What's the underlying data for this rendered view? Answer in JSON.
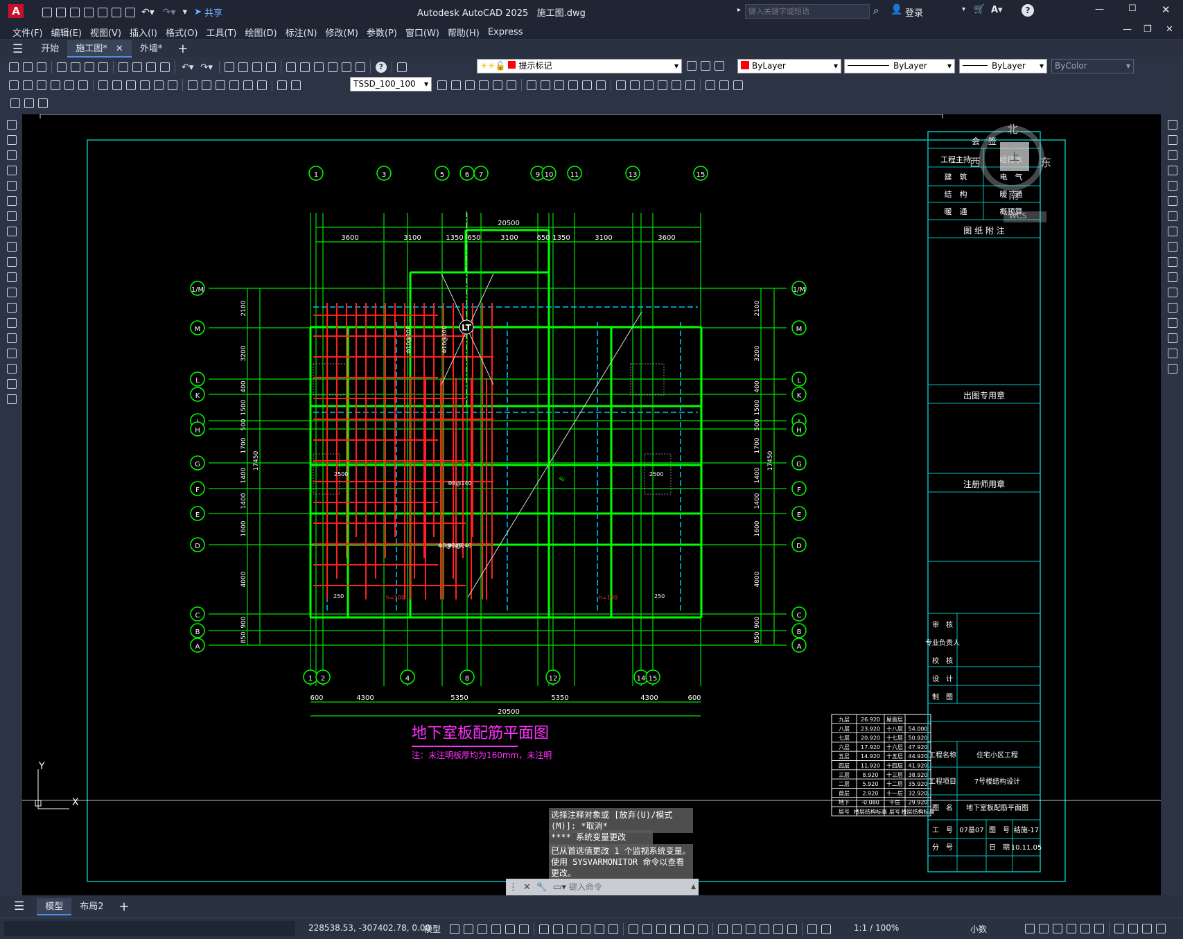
{
  "app": {
    "title": "Autodesk AutoCAD 2025",
    "file": "施工图.dwg",
    "share": "共享",
    "search_placeholder": "键入关键字或短语",
    "login": "登录"
  },
  "menu": [
    "文件(F)",
    "编辑(E)",
    "视图(V)",
    "插入(I)",
    "格式(O)",
    "工具(T)",
    "绘图(D)",
    "标注(N)",
    "修改(M)",
    "参数(P)",
    "窗口(W)",
    "帮助(H)",
    "Express"
  ],
  "doc_tabs": [
    {
      "label": "开始",
      "active": false
    },
    {
      "label": "施工图*",
      "active": true
    },
    {
      "label": "外墙*",
      "active": false
    }
  ],
  "toolbar": {
    "layer": "提示标记",
    "color": "ByLayer",
    "linetype": "ByLayer",
    "lineweight": "ByLayer",
    "plotstyle": "ByColor",
    "dimstyle": "TSSD_100_100"
  },
  "viewcube": {
    "north": "北",
    "south": "南",
    "east": "东",
    "west": "西",
    "top": "上",
    "wcs": "WCS"
  },
  "drawing": {
    "top_axes": [
      "1",
      "3",
      "5",
      "6",
      "7",
      "9",
      "10",
      "11",
      "13",
      "15"
    ],
    "bottom_axes": [
      "1",
      "2",
      "4",
      "8",
      "12",
      "14",
      "15"
    ],
    "side_axes": [
      "1/M",
      "M",
      "L",
      "K",
      "J",
      "H",
      "G",
      "F",
      "E",
      "D",
      "C",
      "B",
      "A"
    ],
    "overall_width": "20500",
    "top_dims": [
      "3600",
      "3100",
      "1350",
      "650",
      "3100",
      "650",
      "1350",
      "3100",
      "3600"
    ],
    "bottom_dims": [
      "600",
      "4300",
      "5350",
      "5350",
      "4300",
      "600"
    ],
    "left_dims": [
      "2100",
      "3200",
      "400",
      "1500",
      "500",
      "1700",
      "1400",
      "1400",
      "1600",
      "4000",
      "900",
      "850"
    ],
    "overall_height": "17450",
    "stair_label": "LT",
    "rebar_labels": [
      "Φ10@100",
      "Φ10@100",
      "Φ8@140",
      "Φ8@140",
      "Φ8@140",
      "2500",
      "2500",
      "250",
      "250",
      "h=100",
      "h=100"
    ],
    "plan_title": "地下室板配筋平面图",
    "plan_note": "注：未注明板厚均为160mm，未注明"
  },
  "level_table": [
    [
      "九层",
      "26.920",
      "屋面层",
      ""
    ],
    [
      "八层",
      "23.920",
      "十八层",
      "54.000"
    ],
    [
      "七层",
      "20.920",
      "十七层",
      "50.920"
    ],
    [
      "六层",
      "17.920",
      "十六层",
      "47.920"
    ],
    [
      "五层",
      "14.920",
      "十五层",
      "44.920"
    ],
    [
      "四层",
      "11.920",
      "十四层",
      "41.920"
    ],
    [
      "三层",
      "8.920",
      "十三层",
      "38.920"
    ],
    [
      "二层",
      "5.920",
      "十二层",
      "35.920"
    ],
    [
      "首层",
      "2.920",
      "十一层",
      "32.920"
    ],
    [
      "地下",
      "-0.080",
      "十层",
      "29.920"
    ],
    [
      "层号",
      "楼层结构标高",
      "层号",
      "楼层结构标高"
    ]
  ],
  "title_block": {
    "sign_header": "会　签",
    "sign_rows": [
      [
        "工程主持",
        "给排水"
      ],
      [
        "建　筑",
        "电　气"
      ],
      [
        "结　构",
        "暖　通"
      ],
      [
        "暖　通",
        "概预算"
      ]
    ],
    "notes": "图 纸 附 注",
    "stamp1": "出图专用章",
    "stamp2": "注册师用章",
    "approvals": [
      "审　核",
      "专业负责人",
      "校　核",
      "设　计",
      "制　图"
    ],
    "project_name_label": "工程名称",
    "project_name": "住宅小区工程",
    "project_item_label": "工程项目",
    "project_item": "7号楼结构设计",
    "drawing_name_label": "图　名",
    "drawing_name": "地下室板配筋平面图",
    "job_label": "工　号",
    "job_no": "07基07",
    "dwg_no_label": "图　号",
    "dwg_no": "结施-17",
    "part_label": "分　号",
    "date_label": "日　期",
    "date": "10.11.05"
  },
  "command": {
    "history": [
      "选择注释对象或 [放弃(U)/模式(M)]: *取消*",
      "**** 系统变量更改 ****",
      "已从首选值更改 1 个监视系统变量。使用 SYSVARMONITOR 命令以查看更改。"
    ],
    "placeholder": "键入命令"
  },
  "layouts": [
    "模型",
    "布局2"
  ],
  "status": {
    "coords": "228538.53, -307402.78, 0.00",
    "model": "模型",
    "scale": "1:1 / 100%",
    "units": "小数"
  },
  "ucs": {
    "y": "Y",
    "x": "X"
  }
}
